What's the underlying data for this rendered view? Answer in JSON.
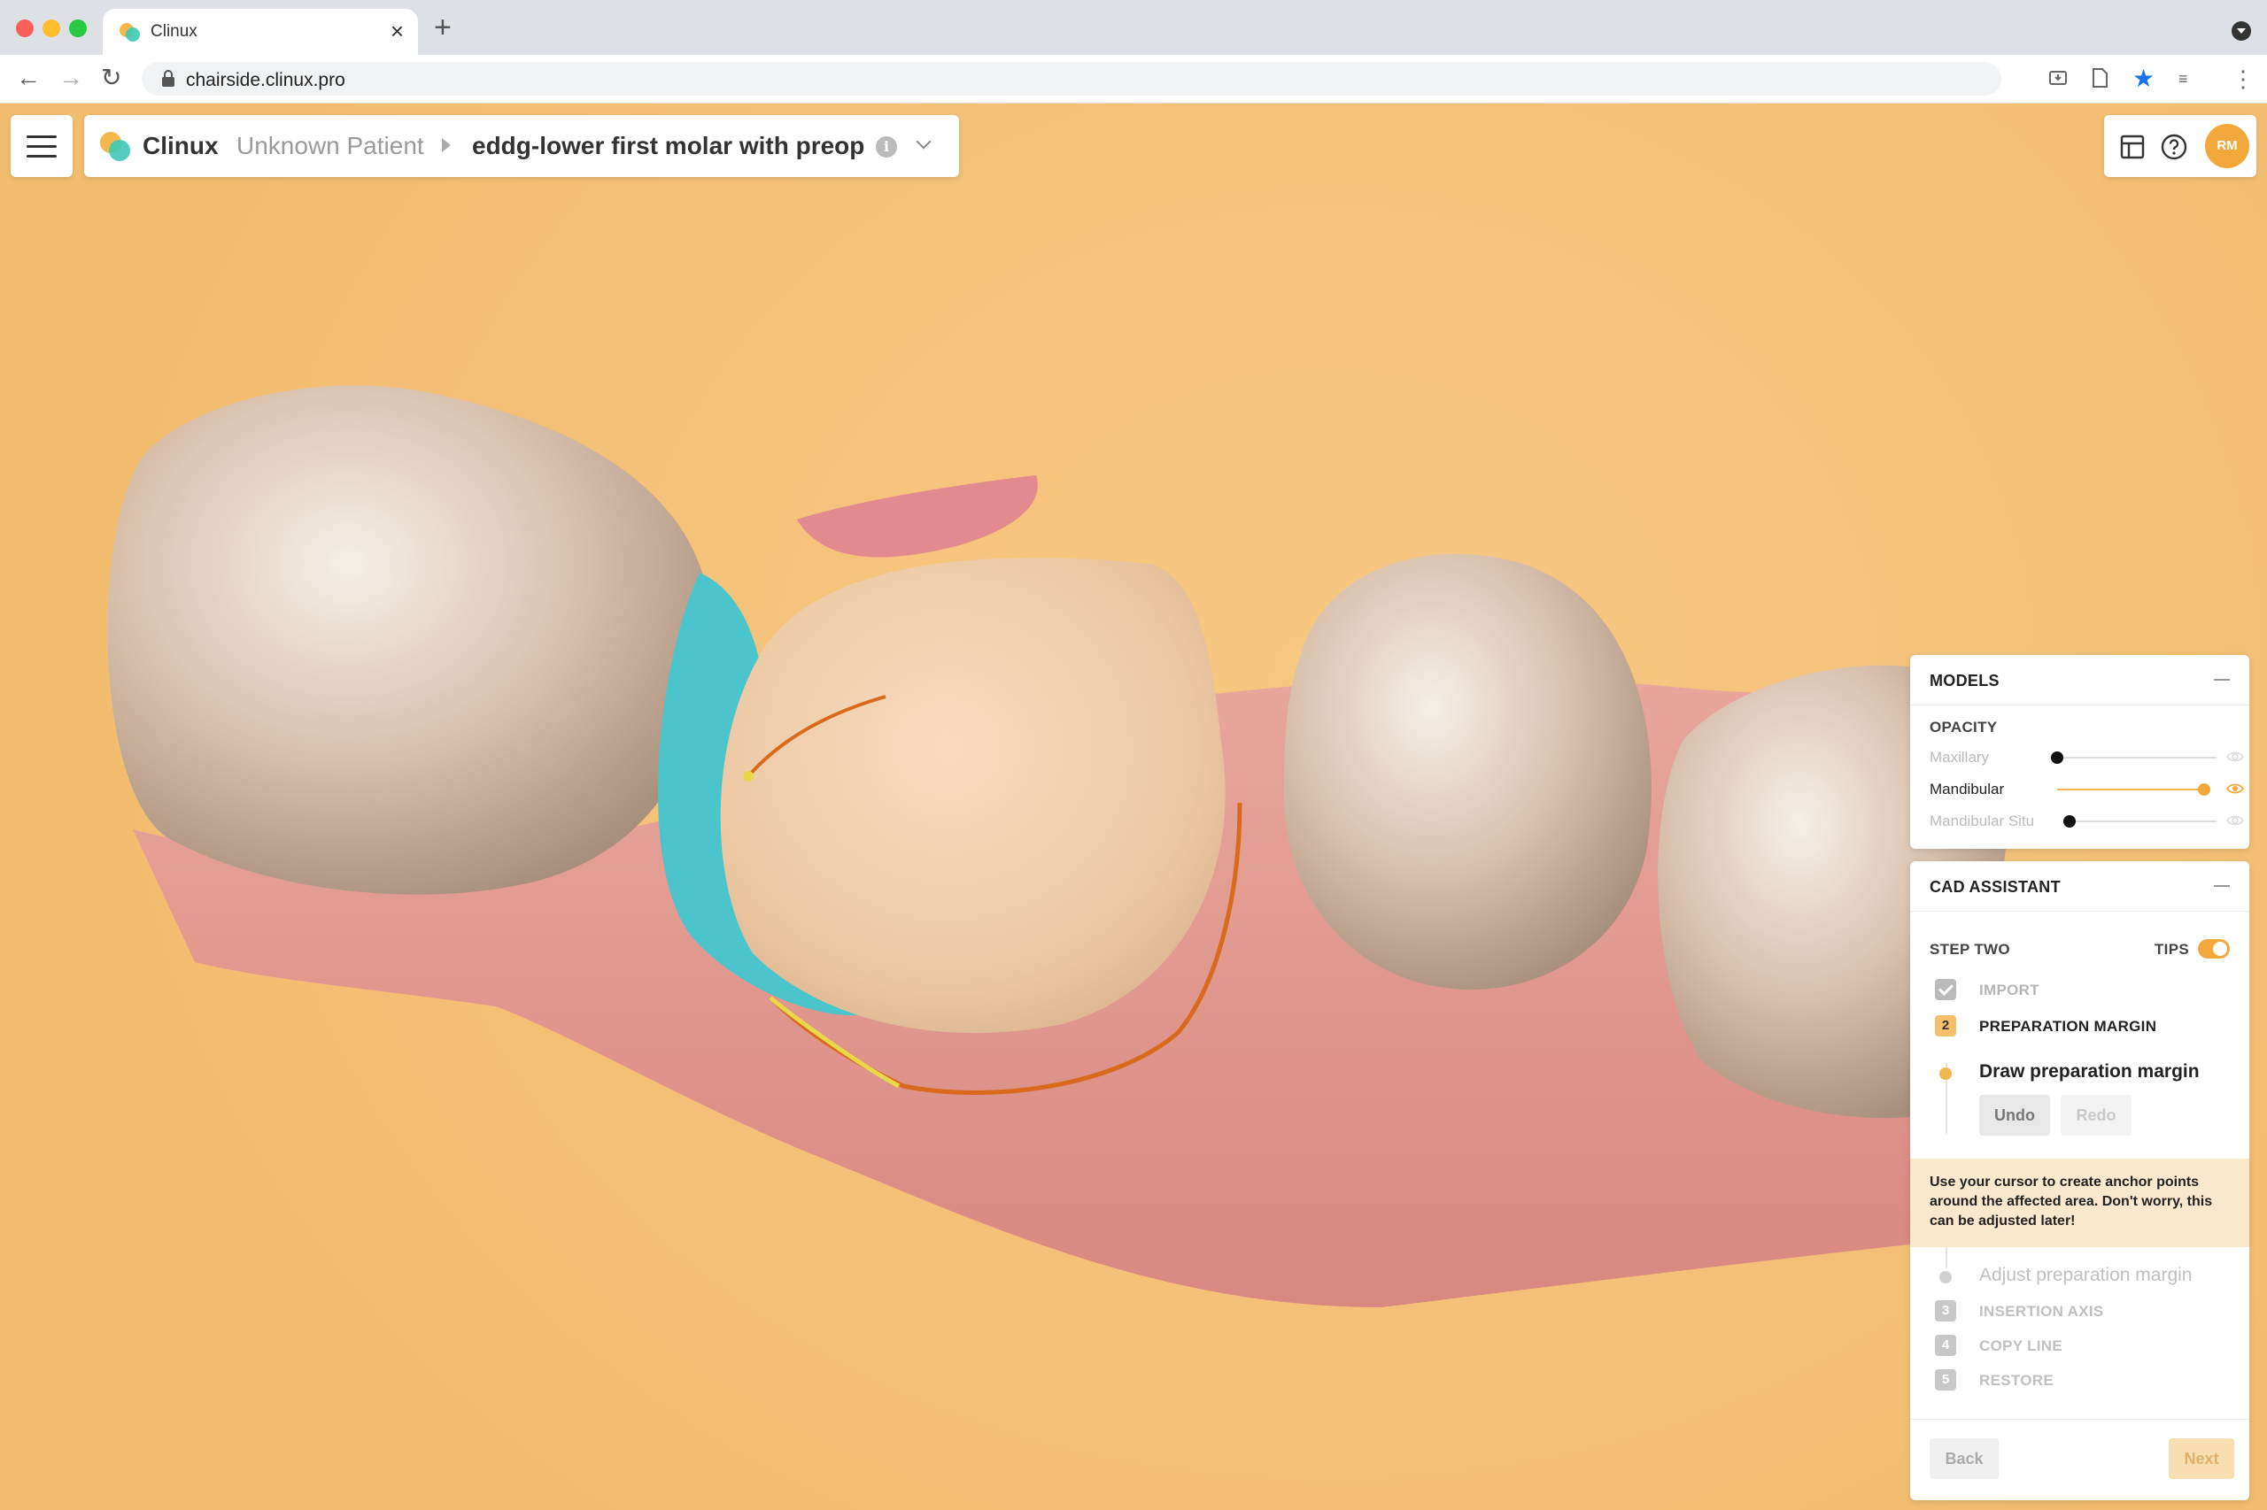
{
  "browser": {
    "tab_title": "Clinux",
    "close_glyph": "×",
    "new_tab_glyph": "+",
    "url": "chairside.clinux.pro",
    "back_glyph": "←",
    "forward_glyph": "→",
    "reload_glyph": "↻",
    "menu_glyph": "⋮",
    "star_glyph": "★",
    "extension_glyph": "≡"
  },
  "header": {
    "brand": "Clinux",
    "patient": "Unknown Patient",
    "case_name": "eddg-lower first molar with preop",
    "info_glyph": "i",
    "avatar_initials": "RM"
  },
  "models_panel": {
    "title": "MODELS",
    "opacity_label": "OPACITY",
    "rows": [
      {
        "label": "Maxillary",
        "value": 0,
        "active": false
      },
      {
        "label": "Mandibular",
        "value": 1,
        "active": true
      },
      {
        "label": "Mandibular Situ",
        "value": 0,
        "active": false
      }
    ]
  },
  "cad_panel": {
    "title": "CAD ASSISTANT",
    "step_title": "STEP TWO",
    "tips_label": "TIPS",
    "steps": [
      {
        "num": "",
        "label": "IMPORT",
        "state": "done"
      },
      {
        "num": "2",
        "label": "PREPARATION MARGIN",
        "state": "active"
      },
      {
        "num": "3",
        "label": "INSERTION AXIS",
        "state": "pending"
      },
      {
        "num": "4",
        "label": "COPY LINE",
        "state": "pending"
      },
      {
        "num": "5",
        "label": "RESTORE",
        "state": "pending"
      }
    ],
    "substep_active": "Draw preparation margin",
    "substep_next": "Adjust preparation margin",
    "undo_label": "Undo",
    "redo_label": "Redo",
    "tip_text": "Use your cursor to create anchor points around the affected area. Don't worry, this can be adjusted later!",
    "back_label": "Back",
    "next_label": "Next"
  },
  "colors": {
    "accent": "#f3a83c",
    "background": "#f5c27a",
    "tip_bg": "#fce8cc",
    "margin_line": "#d96a1c"
  }
}
